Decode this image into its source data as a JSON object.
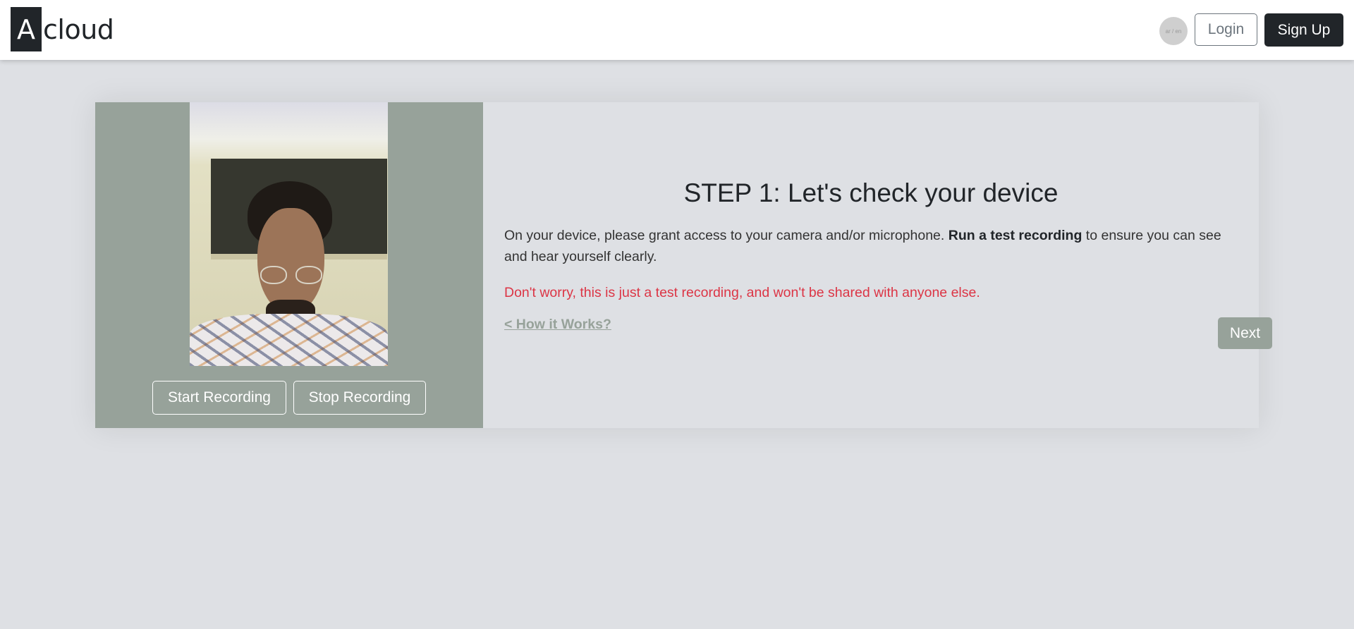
{
  "navbar": {
    "logo_mark": "A",
    "logo_text": "cloud",
    "lang_toggle_label": "ar / en",
    "login_label": "Login",
    "signup_label": "Sign Up"
  },
  "recorder": {
    "start_label": "Start Recording",
    "stop_label": "Stop Recording"
  },
  "step": {
    "title": "STEP 1: Let's check your device",
    "desc_before": "On your device, please grant access to your camera and/or microphone. ",
    "desc_bold": "Run a test recording",
    "desc_after": " to ensure you can see and hear yourself clearly.",
    "notice": "Don't worry, this is just a test recording, and won't be shared with anyone else.",
    "how_link": "< How it Works?",
    "next_label": "Next"
  },
  "colors": {
    "accent_sage": "#97a29a",
    "dark": "#212529",
    "danger": "#dc3545",
    "page_bg": "#dee0e4"
  },
  "icons": {
    "lang_toggle": "language-toggle-icon"
  }
}
